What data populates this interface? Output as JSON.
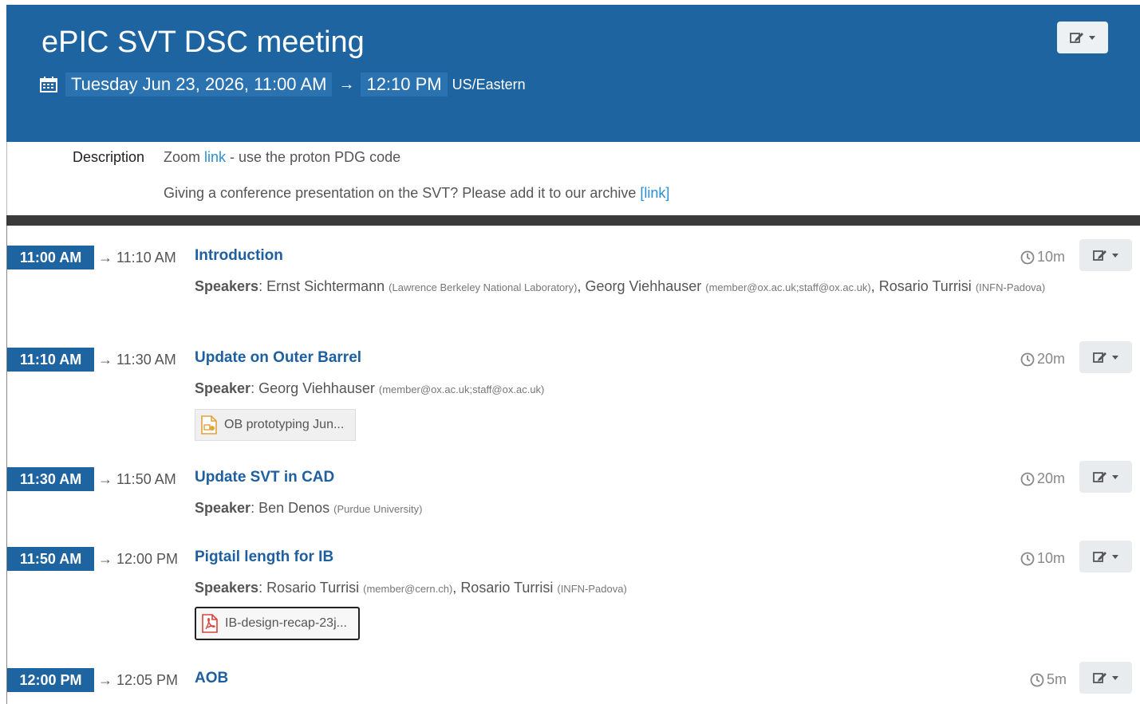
{
  "header": {
    "title": "ePIC SVT DSC meeting",
    "date_start": "Tuesday Jun 23, 2026, 11:00 AM",
    "arrow": "→",
    "date_end": "12:10 PM",
    "timezone": "US/Eastern"
  },
  "description": {
    "label": "Description",
    "line1_prefix": "Zoom ",
    "line1_link": "link",
    "line1_suffix": " - use the proton PDG code",
    "line2_text": "Giving a conference presentation on the SVT?  Please add it to our archive ",
    "line2_link": "[link]"
  },
  "contributions": [
    {
      "start": "11:00 AM",
      "end": "→ 11:10 AM",
      "title": "Introduction",
      "speakers_label": "Speakers",
      "speakers": [
        {
          "name": "Ernst Sichtermann",
          "aff": "(Lawrence Berkeley National Laboratory)"
        },
        {
          "name": "Georg Viehhauser",
          "aff": "(member@ox.ac.uk;staff@ox.ac.uk)"
        },
        {
          "name": "Rosario Turrisi",
          "aff": "(INFN-Padova)"
        }
      ],
      "duration": "10m"
    },
    {
      "start": "11:10 AM",
      "end": "→ 11:30 AM",
      "title": "Update on Outer Barrel",
      "speakers_label": "Speaker",
      "speakers": [
        {
          "name": "Georg Viehhauser",
          "aff": "(member@ox.ac.uk;staff@ox.ac.uk)"
        }
      ],
      "duration": "20m",
      "attachment": "OB prototyping Jun..."
    },
    {
      "start": "11:30 AM",
      "end": "→ 11:50 AM",
      "title": "Update SVT in CAD",
      "speakers_label": "Speaker",
      "speakers": [
        {
          "name": "Ben Denos",
          "aff": "(Purdue University)"
        }
      ],
      "duration": "20m"
    },
    {
      "start": "11:50 AM",
      "end": "→ 12:00 PM",
      "title": "Pigtail length for IB",
      "speakers_label": "Speakers",
      "speakers": [
        {
          "name": "Rosario Turrisi",
          "aff": "(member@cern.ch)"
        },
        {
          "name": "Rosario Turrisi",
          "aff": "(INFN-Padova)"
        }
      ],
      "duration": "10m",
      "attachment": "IB-design-recap-23j..."
    },
    {
      "start": "12:00 PM",
      "end": "→ 12:05 PM",
      "title": "AOB",
      "duration": "5m"
    }
  ],
  "icons": {
    "calendar": "calendar-icon",
    "edit": "edit-icon",
    "clock": "clock-icon",
    "presentation": "presentation-file-icon",
    "pdf": "pdf-file-icon"
  },
  "colors": {
    "header_bg": "#1e64a1",
    "link": "#2a8fd0",
    "title_link": "#1e5fa0"
  }
}
